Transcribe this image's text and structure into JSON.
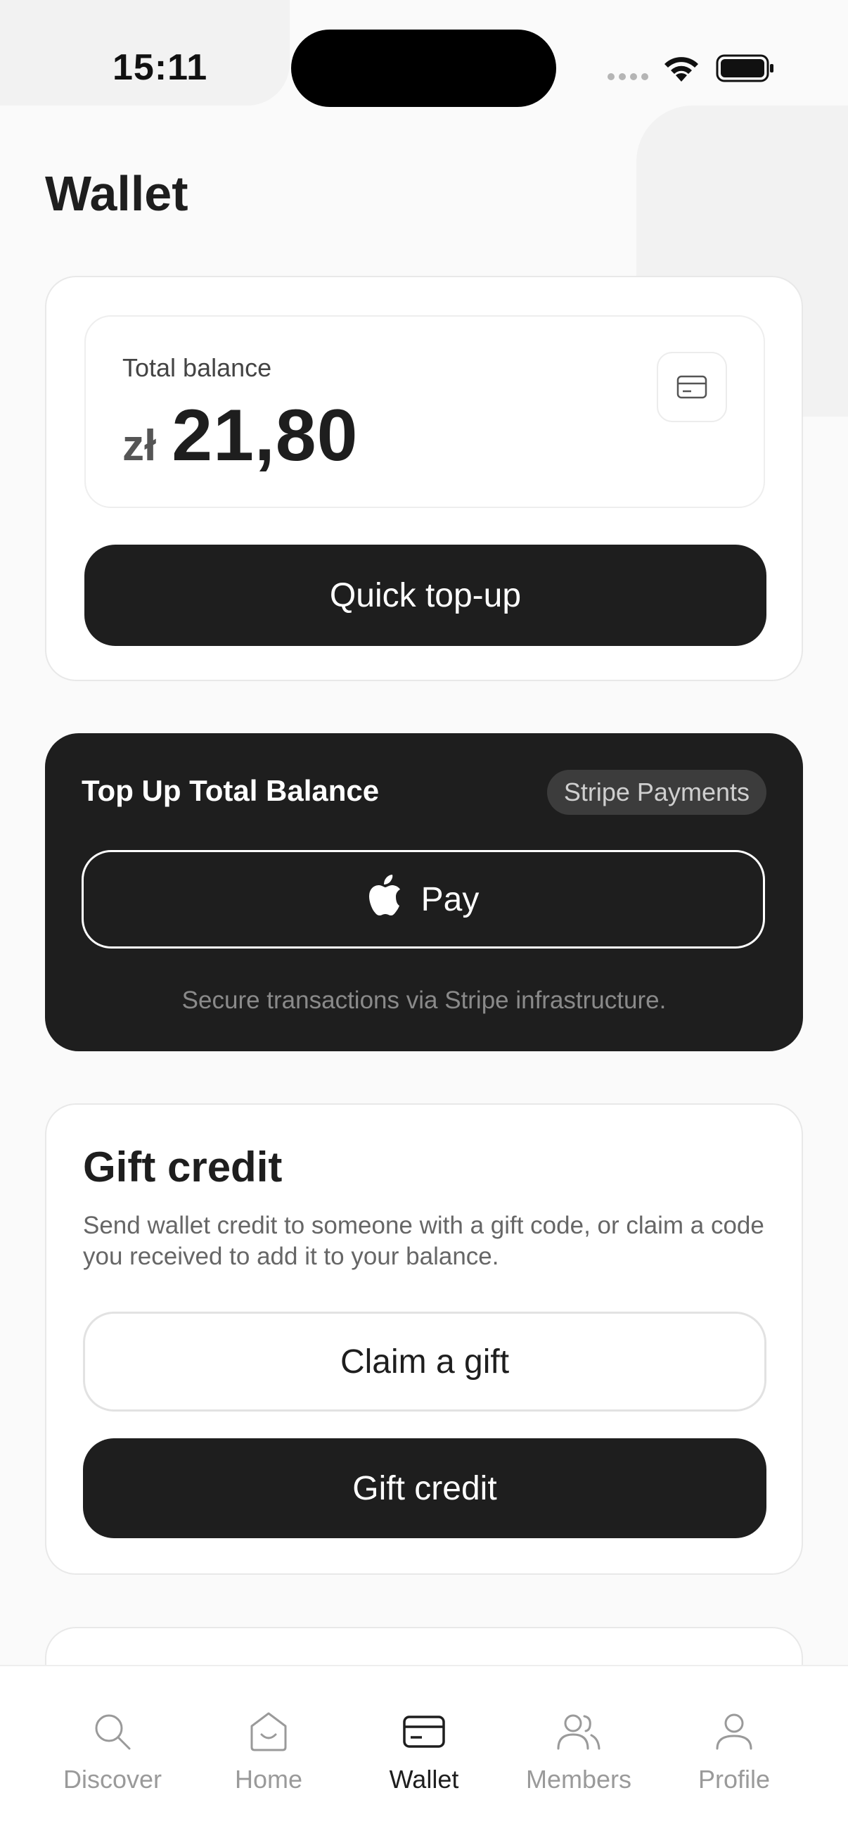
{
  "status_bar": {
    "time": "15:11"
  },
  "page": {
    "title": "Wallet"
  },
  "balance": {
    "label": "Total balance",
    "currency": "zł",
    "amount": "21,80",
    "card_icon": "credit-card-icon",
    "quick_topup_label": "Quick top-up"
  },
  "topup": {
    "title": "Top Up Total Balance",
    "badge": "Stripe Payments",
    "apple_pay_label": "Pay",
    "apple_icon": "apple-icon",
    "note": "Secure transactions via Stripe infrastructure."
  },
  "gift": {
    "title": "Gift credit",
    "description": "Send wallet credit to someone with a gift code, or claim a code you received to add it to your balance.",
    "claim_label": "Claim a gift",
    "gift_label": "Gift credit"
  },
  "tabbar": {
    "items": [
      {
        "label": "Discover",
        "icon": "search-icon",
        "active": false
      },
      {
        "label": "Home",
        "icon": "home-icon",
        "active": false
      },
      {
        "label": "Wallet",
        "icon": "wallet-icon",
        "active": true
      },
      {
        "label": "Members",
        "icon": "members-icon",
        "active": false
      },
      {
        "label": "Profile",
        "icon": "profile-icon",
        "active": false
      }
    ]
  },
  "colors": {
    "background": "#fafafa",
    "dark": "#1e1e1e",
    "muted": "#9a9a9a"
  }
}
